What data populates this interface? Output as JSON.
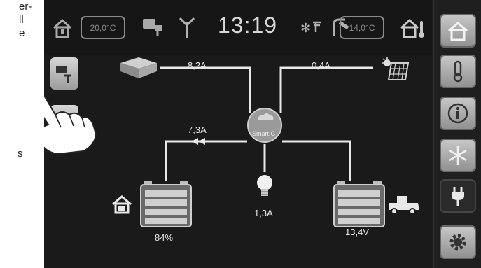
{
  "manual": {
    "line1": "er-",
    "line2": "ll",
    "line3": "e",
    "line4": "s"
  },
  "header": {
    "time": "13:19",
    "inside_temp": "20,0°C",
    "outside_temp": "14,0°C"
  },
  "flows": {
    "charger_current": "8,2A",
    "solar_current": "0,4A",
    "house_battery_current": "7,3A",
    "consumer_current": "1,3A",
    "hub_label": "Smart.C"
  },
  "batteries": {
    "house": {
      "level_percent": 84,
      "label": "84%"
    },
    "vehicle": {
      "voltage": "13,4V"
    }
  },
  "sidebar": [
    "home-icon",
    "thermometer-icon",
    "info-icon",
    "snowflake-icon",
    "plug-icon",
    "gear-icon"
  ],
  "colors": {
    "screen_bg": "#1a1a1a",
    "line": "#e8e8e8",
    "button": "#b5b5b5"
  }
}
